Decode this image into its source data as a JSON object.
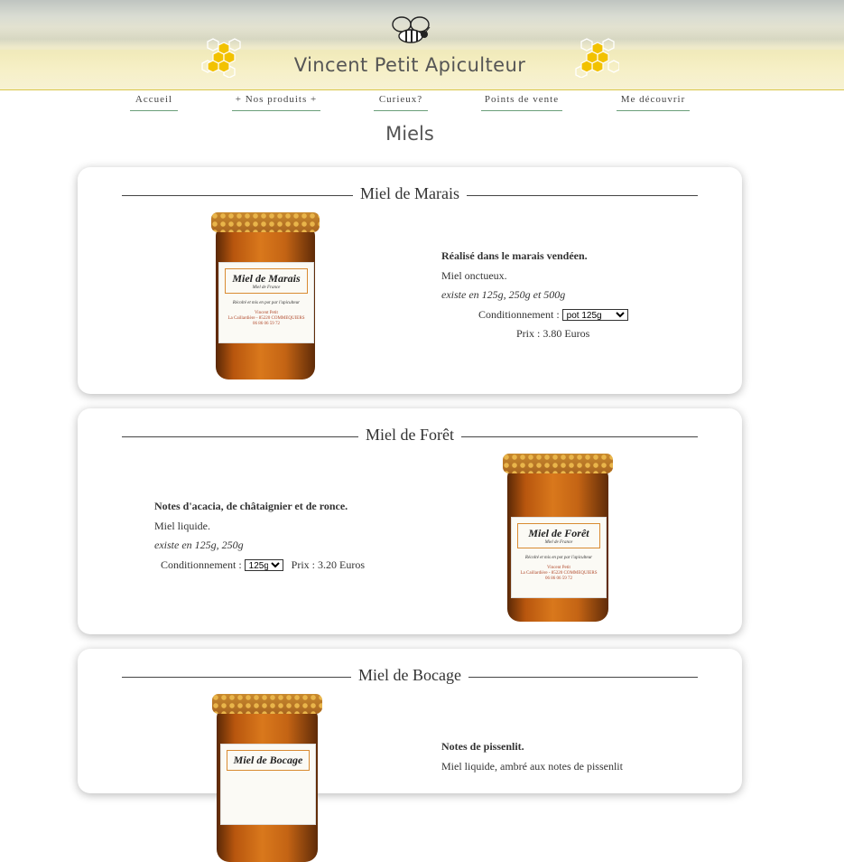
{
  "header": {
    "title": "Vincent Petit Apiculteur",
    "bee_icon": "bee-icon",
    "comb_icon": "honeycomb-icon"
  },
  "nav": {
    "items": [
      {
        "label": "Accueil"
      },
      {
        "label": "+ Nos produits +"
      },
      {
        "label": "Curieux?"
      },
      {
        "label": "Points de vente"
      },
      {
        "label": "Me découvrir"
      }
    ]
  },
  "page": {
    "title": "Miels"
  },
  "products": [
    {
      "name": "Miel de Marais",
      "lead": "Réalisé dans le marais vendéen.",
      "texture": "Miel onctueux.",
      "sizes": "existe en 125g, 250g et 500g",
      "packaging_label": "Conditionnement :",
      "packaging_value": "pot 125g",
      "price": "Prix : 3.80 Euros",
      "jar": {
        "label_name": "Miel de Marais",
        "label_sub": "Miel de France",
        "label_line": "Récolté et mis en pot par l'apiculteur",
        "label_producer": "Vincent Petit",
        "label_address": "La Caillardière - 85220 COMMEQUIERS",
        "label_phone": "06 86 06 59 72"
      }
    },
    {
      "name": "Miel de Forêt",
      "lead": "Notes d'acacia, de châtaignier et de ronce.",
      "texture": "Miel liquide.",
      "sizes": "existe en 125g, 250g",
      "packaging_label": "Conditionnement :",
      "packaging_value": "125g",
      "price": "Prix : 3.20 Euros",
      "jar": {
        "label_name": "Miel de Forêt",
        "label_sub": "Miel de France",
        "label_line": "Récolté et mis en pot par l'apiculteur",
        "label_producer": "Vincent Petit",
        "label_address": "La Caillardière - 85220 COMMEQUIERS",
        "label_phone": "06 86 06 59 72"
      }
    },
    {
      "name": "Miel de Bocage",
      "lead": "Notes de pissenlit.",
      "texture": "Miel liquide, ambré aux notes de pissenlit",
      "jar": {
        "label_name": "Miel de Bocage"
      }
    }
  ],
  "colors": {
    "nav_underline": "#6b9f7a",
    "header_border": "#d9c64a",
    "comb_yellow": "#f2c200"
  }
}
